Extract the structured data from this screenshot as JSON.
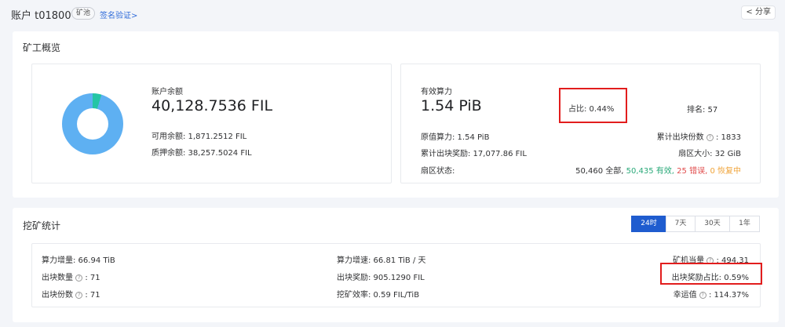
{
  "header": {
    "account_title": "账户 t01800",
    "pool_tag": "矿池",
    "verify_link": "签名验证>",
    "share_label": "分享",
    "share_icon": "share-icon"
  },
  "overview": {
    "title": "矿工概览",
    "chart_data": {
      "type": "pie",
      "series": [
        {
          "label": "可用余额",
          "value": 1871.2512,
          "color": "#24c5a5"
        },
        {
          "label": "质押余额",
          "value": 38257.5024,
          "color": "#5eb0f2"
        }
      ]
    },
    "balance": {
      "label": "账户余额",
      "value": "40,128.7536 FIL",
      "available": "可用余额: 1,871.2512 FIL",
      "pledged": "质押余额: 38,257.5024 FIL"
    },
    "power": {
      "label": "有效算力",
      "value": "1.54 PiB",
      "share": "占比: 0.44%",
      "rank": "排名: 57",
      "raw_power": "原值算力: 1.54 PiB",
      "blocks_label": "累计出块份数",
      "blocks_value": ": 1833",
      "total_reward": "累计出块奖励: 17,077.86 FIL",
      "sector_size": "扇区大小: 32 GiB",
      "sector_status_label": "扇区状态:",
      "sector_total": "50,460 全部,",
      "sector_active": "50,435 有效,",
      "sector_faulty": "25 错误,",
      "sector_recovering": "0 恢复中",
      "colors": {
        "active": "#2aa979",
        "faulty": "#e04b4b",
        "recovering": "#f0a43a"
      }
    }
  },
  "stats": {
    "title": "挖矿统计",
    "periods": [
      "24时",
      "7天",
      "30天",
      "1年"
    ],
    "active_period": "24时",
    "power_increase": "算力增量: 66.94 TiB",
    "blocks_label": "出块数量",
    "blocks_value": ": 71",
    "win_count_label": "出块份数",
    "win_count_value": ": 71",
    "power_rate": "算力增速: 66.81 TiB / 天",
    "block_reward": "出块奖励: 905.1290 FIL",
    "efficiency": "挖矿效率: 0.59 FIL/TiB",
    "equivalent_label": "矿机当量",
    "equivalent_value": ": 494.31",
    "reward_ratio": "出块奖励占比: 0.59%",
    "luck_label": "幸运值",
    "luck_value": ": 114.37%"
  },
  "accent_color": "#1f5ccf",
  "highlight_color": "#e21d1d"
}
